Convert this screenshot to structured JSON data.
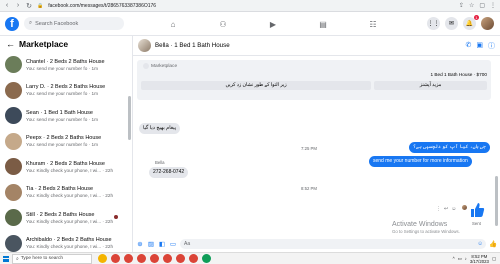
{
  "browser": {
    "url": "facebook.com/messages/t/2865763387386O176",
    "back_icon": "arrow-left-icon",
    "forward_icon": "arrow-right-icon",
    "reload_icon": "reload-icon"
  },
  "fb": {
    "logo": "f",
    "search_placeholder": "Search Facebook",
    "notifications_badge": "1"
  },
  "sidebar": {
    "title": "Marketplace",
    "conversations": [
      {
        "name": "Chantel · 2 Beds 2 Baths House",
        "preview": "You: send me your number fo · 1m",
        "color": "#6b7d5a"
      },
      {
        "name": "Larry D. · 2 Beds 2 Baths House",
        "preview": "You: send me your number fo · 1m",
        "color": "#8b6a4e"
      },
      {
        "name": "Sean · 1 Bed 1 Bath House",
        "preview": "You: send me your number fo · 1m",
        "color": "#3d4a5a"
      },
      {
        "name": "Peepx · 2 Beds 2 Baths House",
        "preview": "You: send me your number fo · 1m",
        "color": "#c5a98a"
      },
      {
        "name": "Khuram · 2 Beds 2 Baths House",
        "preview": "You: Kindly check your phone, I wi... · 22h",
        "color": "#7b5c45"
      },
      {
        "name": "Tia · 2 Beds 2 Baths House",
        "preview": "You: Kindly check your phone, I wi... · 22h",
        "color": "#a48466"
      },
      {
        "name": "Still · 2 Beds 2 Baths House",
        "preview": "You: Kindly check your phone, I wi... · 22h",
        "color": "#5a6a4a",
        "unread": true
      },
      {
        "name": "Archibaldo · 2 Beds 2 Baths House",
        "preview": "You: Kindly check your phone, I wi... · 22h",
        "color": "#4a5560"
      }
    ]
  },
  "chat": {
    "contact": "Bella · 1 Bed 1 Bath House",
    "marketplace_label": "Marketplace",
    "listing": "1 Bed 1 Bath House · $700",
    "buttons": [
      "زیر التوا کے طور نشان زد کریں",
      "مزید آپشنز"
    ],
    "messages": {
      "in1": "پیغام بھیج دیا گیا",
      "out1": "جی ہاں، کیا آپ کو دلچسپی ہے؟",
      "out2": "send me your number for more information",
      "time1": "7:25 PM",
      "sender": "Bella",
      "in2": "272-268-0742",
      "time2": "8:52 PM"
    },
    "composer_placeholder": "Aa"
  },
  "watermark": {
    "line1": "Activate Windows",
    "line2": "Go to Settings to activate Windows."
  },
  "taskbar": {
    "search": "Type here to search",
    "time": "8:52 PM",
    "date": "3/17/2023"
  }
}
